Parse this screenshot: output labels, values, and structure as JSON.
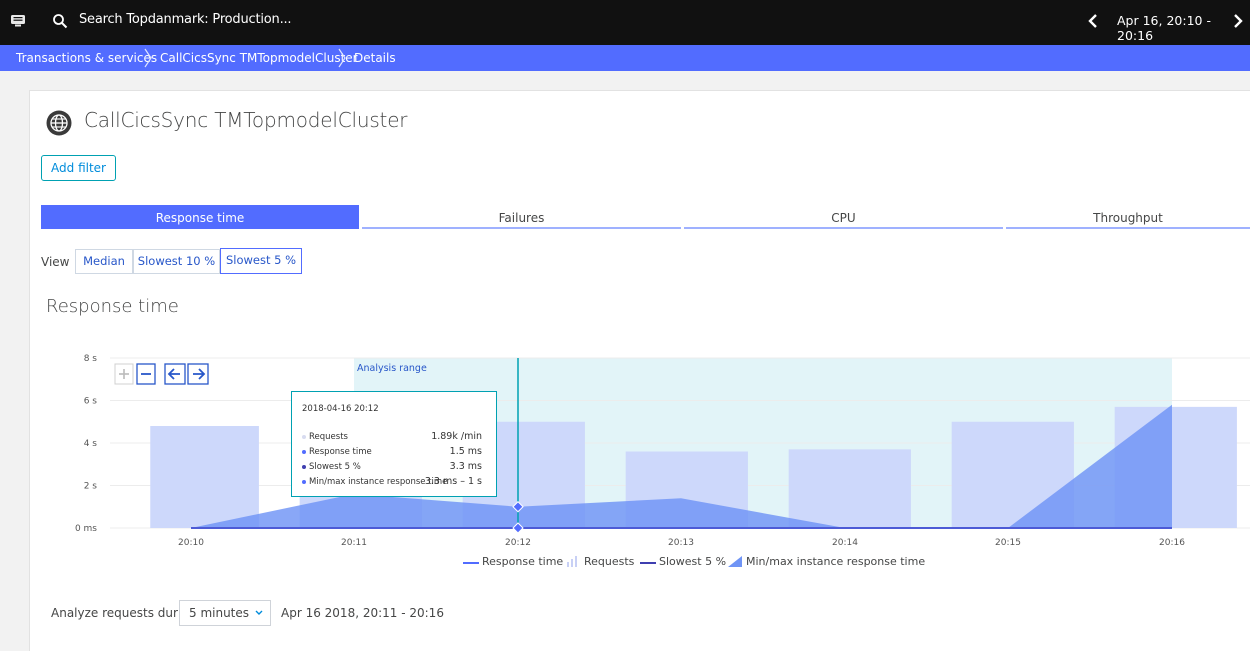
{
  "topbar": {
    "search_placeholder": "Search Topdanmark: Production...",
    "timeframe": "Apr 16, 20:10 - 20:16"
  },
  "breadcrumbs": [
    "Transactions & services",
    "CallCicsSync TMTopmodelCluster",
    "Details"
  ],
  "entity": {
    "title": "CallCicsSync TMTopmodelCluster",
    "icon": "globe-icon"
  },
  "add_filter_label": "Add filter",
  "tabs": [
    {
      "label": "Response time",
      "active": true
    },
    {
      "label": "Failures",
      "active": false
    },
    {
      "label": "CPU",
      "active": false
    },
    {
      "label": "Throughput",
      "active": false
    }
  ],
  "view": {
    "label": "View",
    "options": [
      {
        "label": "Median",
        "selected": false
      },
      {
        "label": "Slowest 10 %",
        "selected": false
      },
      {
        "label": "Slowest 5 %",
        "selected": true
      }
    ]
  },
  "section_title": "Response time",
  "chart_data": {
    "type": "bar",
    "title": "Response time",
    "x": [
      "20:10",
      "20:11",
      "20:12",
      "20:13",
      "20:14",
      "20:15",
      "20:16"
    ],
    "y_ticks": [
      "0 ms",
      "2 s",
      "4 s",
      "6 s",
      "8 s"
    ],
    "ylim": [
      0,
      8
    ],
    "analysis_range_label": "Analysis range",
    "analysis_range": [
      "20:11",
      "20:16"
    ],
    "requests_bars": [
      {
        "start": "20:09:45",
        "end": "20:10:25",
        "value": 4.8
      },
      {
        "start": "20:10:40",
        "end": "20:11:25",
        "value": 1.5
      },
      {
        "start": "20:11:40",
        "end": "20:12:25",
        "value": 5.0
      },
      {
        "start": "20:12:40",
        "end": "20:13:25",
        "value": 3.6
      },
      {
        "start": "20:13:40",
        "end": "20:14:25",
        "value": 3.7
      },
      {
        "start": "20:14:40",
        "end": "20:15:25",
        "value": 5.0
      },
      {
        "start": "20:15:40",
        "end": "20:16:25",
        "value": 5.7
      }
    ],
    "series": [
      {
        "name": "Min/max instance response time",
        "x": [
          "20:10",
          "20:11",
          "20:12",
          "20:13",
          "20:14",
          "20:15",
          "20:16"
        ],
        "values": [
          0.0,
          1.6,
          1.0,
          1.4,
          0.0,
          0.0,
          5.8
        ]
      },
      {
        "name": "Slowest 5 %",
        "x": [
          "20:10",
          "20:11",
          "20:12",
          "20:13",
          "20:14",
          "20:15",
          "20:16"
        ],
        "values": [
          0.0,
          0.0,
          0.0,
          0.0,
          0.0,
          0.0,
          0.0
        ]
      }
    ],
    "legend": [
      "Response time",
      "Requests",
      "Slowest 5 %",
      "Min/max instance response time"
    ],
    "legend_position": "bottom",
    "colors": {
      "requests": "#cdd8fb",
      "line": "#4d5bd6",
      "area": "#6f94f5",
      "analysis": "#e2f4f8",
      "cursor": "#00a1b2"
    }
  },
  "tooltip": {
    "date": "2018-04-16 20:12",
    "rows": [
      {
        "label": "Requests",
        "value": "1.89k /min"
      },
      {
        "label": "Response time",
        "value": "1.5 ms"
      },
      {
        "label": "Slowest 5 %",
        "value": "3.3 ms"
      },
      {
        "label": "Min/max instance response time",
        "value": "3.3 ms – 1 s"
      }
    ]
  },
  "analyze": {
    "label": "Analyze requests during",
    "duration": "5 minutes",
    "range": "Apr 16 2018, 20:11 - 20:16"
  }
}
